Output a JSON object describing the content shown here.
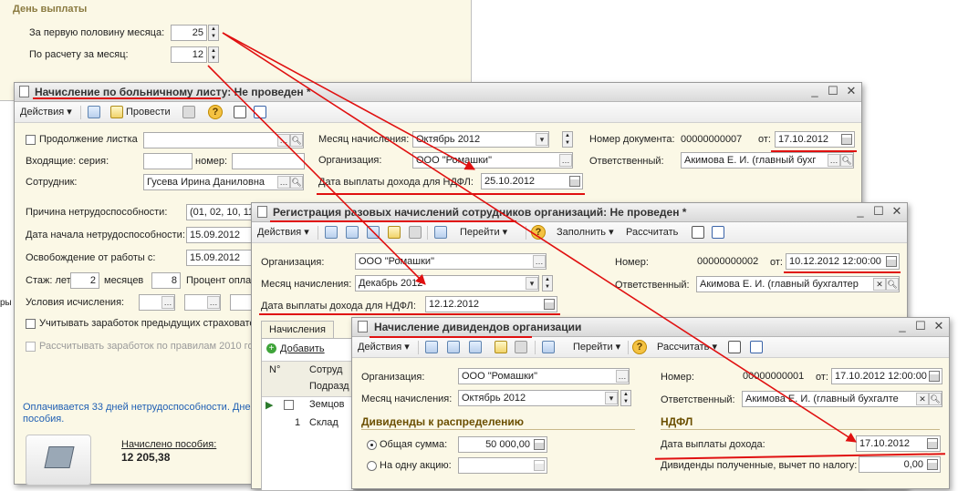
{
  "bg_form": {
    "section_title": "День выплаты",
    "first_half_label": "За первую половину месяца:",
    "first_half_value": "25",
    "monthly_label": "По расчету за месяц:",
    "monthly_value": "12"
  },
  "sick": {
    "title": "Начисление по больничному листу: Не проведен *",
    "toolbar": {
      "actions": "Действия",
      "post": "Провести"
    },
    "continuation_label": "Продолжение листка",
    "incoming_series_label": "Входящие: серия:",
    "number_label": "номер:",
    "employee_label": "Сотрудник:",
    "employee_value": "Гусева Ирина Даниловна",
    "accrual_month_label": "Месяц начисления:",
    "accrual_month_value": "Октябрь 2012",
    "org_label": "Организация:",
    "org_value": "ООО \"Ромашки\"",
    "pay_date_label": "Дата выплаты дохода для НДФЛ:",
    "pay_date_value": "25.10.2012",
    "doc_number_label": "Номер документа:",
    "doc_number_value": "00000000007",
    "from_label": "от:",
    "doc_date_value": "17.10.2012",
    "responsible_label": "Ответственный:",
    "responsible_value": "Акимова Е. И. (главный бухг",
    "reason_label": "Причина нетрудоспособности:",
    "reason_value": "(01, 02, 10, 11",
    "start_label": "Дата начала нетрудоспособности:",
    "start_value": "15.09.2012",
    "release_label": "Освобождение от работы с:",
    "release_value": "15.09.2012",
    "exp_label": "Стаж: лет",
    "exp_years": "2",
    "months_label": "месяцев",
    "exp_months": "8",
    "percent_label": "Процент оплат",
    "conditions_label": "Условия исчисления:",
    "consider_label": "Учитывать заработок предыдущих страховате",
    "calc_label": "Рассчитывать заработок по правилам 2010 го",
    "paid_info_line1": "Оплачивается 33 дней нетрудоспособности. Дне",
    "paid_info_line2": "пособия.",
    "accrued_label": "Начислено пособия:",
    "accrued_value": "12 205,38",
    "left_edge_fragment": "ры"
  },
  "reg": {
    "title": "Регистрация разовых начислений сотрудников организаций: Не проведен *",
    "toolbar": {
      "actions": "Действия",
      "goto": "Перейти",
      "fill": "Заполнить",
      "calculate": "Рассчитать"
    },
    "org_label": "Организация:",
    "org_value": "ООО \"Ромашки\"",
    "month_label": "Месяц начисления:",
    "month_value": "Декабрь 2012",
    "pay_date_label": "Дата выплаты дохода для НДФЛ:",
    "pay_date_value": "12.12.2012",
    "number_label": "Номер:",
    "number_value": "00000000002",
    "from_label": "от:",
    "date_value": "10.12.2012 12:00:00",
    "responsible_label": "Ответственный:",
    "responsible_value": "Акимова Е. И. (главный бухгалтер",
    "tab_label": "Начисления",
    "add_label": "Добавить",
    "grid": {
      "col_no": "N°",
      "col_employee": "Сотруд",
      "col_dept": "Подразд",
      "row1": "Земцов",
      "row2_no": "1",
      "row2": "Склад"
    }
  },
  "div": {
    "title": "Начисление дивидендов организации",
    "toolbar": {
      "actions": "Действия",
      "goto": "Перейти",
      "calculate": "Рассчитать"
    },
    "org_label": "Организация:",
    "org_value": "ООО \"Ромашки\"",
    "month_label": "Месяц начисления:",
    "month_value": "Октябрь 2012",
    "number_label": "Номер:",
    "number_value": "00000000001",
    "from_label": "от:",
    "date_value": "17.10.2012 12:00:00",
    "responsible_label": "Ответственный:",
    "responsible_value": "Акимова Е. И. (главный бухгалте",
    "dividends_section": "Дивиденды к распределению",
    "total_label": "Общая сумма:",
    "total_value": "50 000,00",
    "per_share_label": "На одну акцию:",
    "ndfl_section": "НДФЛ",
    "income_date_label": "Дата выплаты дохода:",
    "income_date_value": "17.10.2012",
    "received_label": "Дивиденды полученные, вычет по налогу:",
    "received_value": "0,00"
  },
  "colors": {
    "annotation": "#e01010",
    "section_title": "#6b4f00",
    "link": "#1f5fb3",
    "form_bg": "#fbf8e6"
  }
}
